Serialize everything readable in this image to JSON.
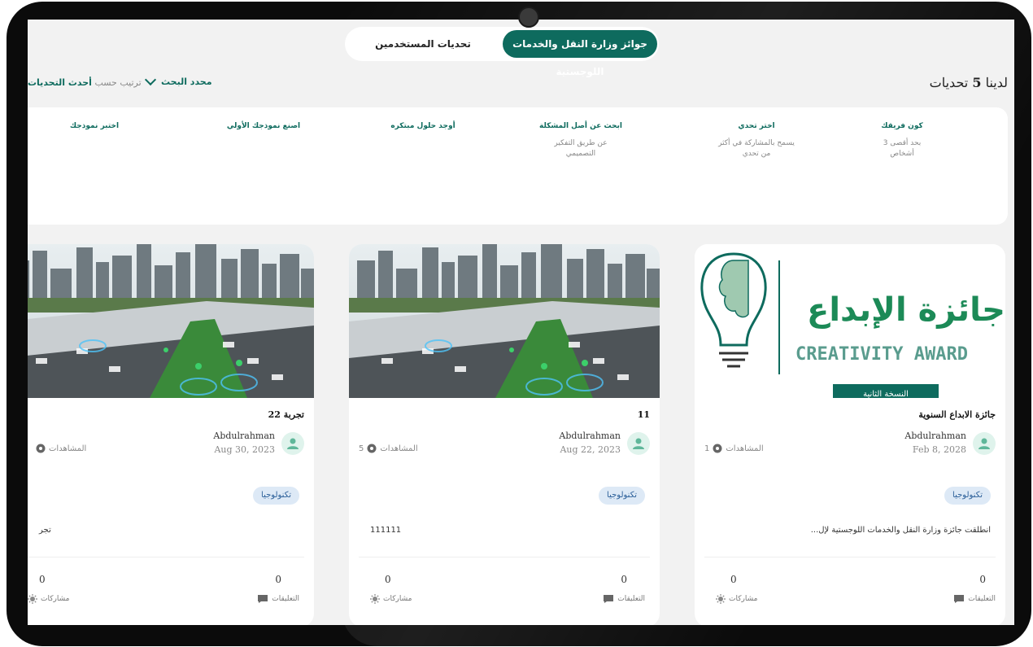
{
  "tabs": {
    "active": "جوائز وزارة النقل والخدمات اللوجستية",
    "inactive": "تحديات المستخدمين"
  },
  "header": {
    "count_prefix": "لدينا",
    "count_number": "5",
    "count_suffix": "تحديات",
    "sort_label": "ترتيب حسب",
    "sort_value": "أحدث التحديات",
    "filter_label": "محدد البحث"
  },
  "steps": [
    {
      "title": "كون فريقك",
      "desc": "بحد أقصى 3 أشخاص"
    },
    {
      "title": "اختر تحدي",
      "desc": "يسمح بالمشاركة في أكثر من تحدي"
    },
    {
      "title": "ابحث عن أصل المشكلة",
      "desc": "عن طريق التفكير التصميمي"
    },
    {
      "title": "أوجد حلول مبتكره",
      "desc": ""
    },
    {
      "title": "اصنع نموذجك الأولي",
      "desc": ""
    },
    {
      "title": "اختبر نموذجك",
      "desc": ""
    }
  ],
  "cards": [
    {
      "title": "جائزة الابداع السنوية",
      "author": "Abdulrahman",
      "date": "Feb 8, 2028",
      "views_label": "المشاهدات",
      "views": "1",
      "tag": "تكنولوجيا",
      "desc": "انطلقت جائزة وزارة النقل والخدمات اللوجستية لإل...",
      "comments": "0",
      "comments_label": "التعليقات",
      "participants": "0",
      "participants_label": "مشاركات",
      "banner": {
        "arabic_title": "جائزة الإبداع",
        "english_title": "CREATIVITY AWARD",
        "edition": "النسخة الثانية"
      }
    },
    {
      "title": "11",
      "author": "Abdulrahman",
      "date": "Aug 22, 2023",
      "views_label": "المشاهدات",
      "views": "5",
      "tag": "تكنولوجيا",
      "desc": "111111",
      "comments": "0",
      "comments_label": "التعليقات",
      "participants": "0",
      "participants_label": "مشاركات"
    },
    {
      "title": "تجربة 22",
      "author": "Abdulrahman",
      "date": "Aug 30, 2023",
      "views_label": "المشاهدات",
      "views": "",
      "tag": "تكنولوجيا",
      "desc": "تجر",
      "comments": "0",
      "comments_label": "التعليقات",
      "participants": "0",
      "participants_label": "مشاركات"
    }
  ],
  "colors": {
    "accent": "#0e6b5e",
    "tag_bg": "#dde9f6",
    "tag_text": "#2b5f99"
  }
}
